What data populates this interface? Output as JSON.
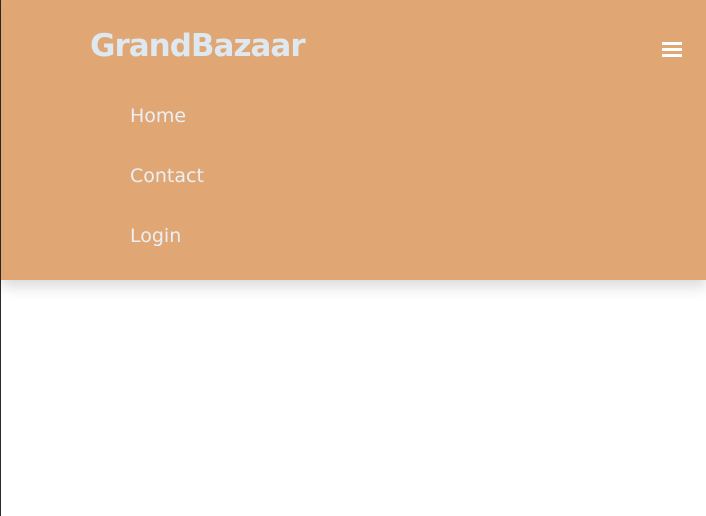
{
  "navbar": {
    "brand": "GrandBazaar",
    "toggle_icon": "hamburger-menu-icon",
    "items": [
      {
        "label": "Home"
      },
      {
        "label": "Contact"
      },
      {
        "label": "Login"
      }
    ]
  },
  "colors": {
    "navbar_background": "#e0a775",
    "brand_text": "#dde8f1",
    "link_text": "#eaf0f5",
    "page_background": "#ffffff"
  }
}
